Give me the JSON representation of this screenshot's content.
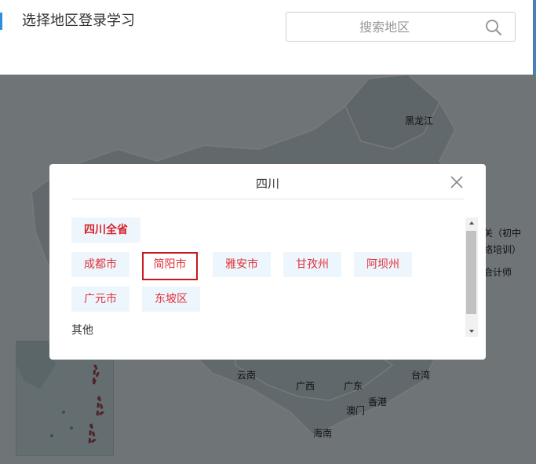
{
  "header": {
    "title": "选择地区登录学习",
    "search_placeholder": "搜索地区"
  },
  "map": {
    "labels": [
      "黑龙江",
      "关（初中",
      "络培训）",
      "会计师",
      "云南",
      "广西",
      "广东",
      "台湾",
      "香港",
      "澳门",
      "海南"
    ],
    "map_color": "#c3d3d8",
    "sea_color": "#dfe9ee"
  },
  "modal": {
    "title": "四川",
    "province_all": "四川全省",
    "cities": [
      "成都市",
      "简阳市",
      "雅安市",
      "甘孜州",
      "阿坝州",
      "广元市",
      "东坡区"
    ],
    "selected_city": "简阳市",
    "other_label": "其他"
  },
  "colors": {
    "accent": "#2b8fe0",
    "chip_text": "#e0323a",
    "chip_bg": "#eef6fd",
    "selected_border": "#c9151e"
  }
}
